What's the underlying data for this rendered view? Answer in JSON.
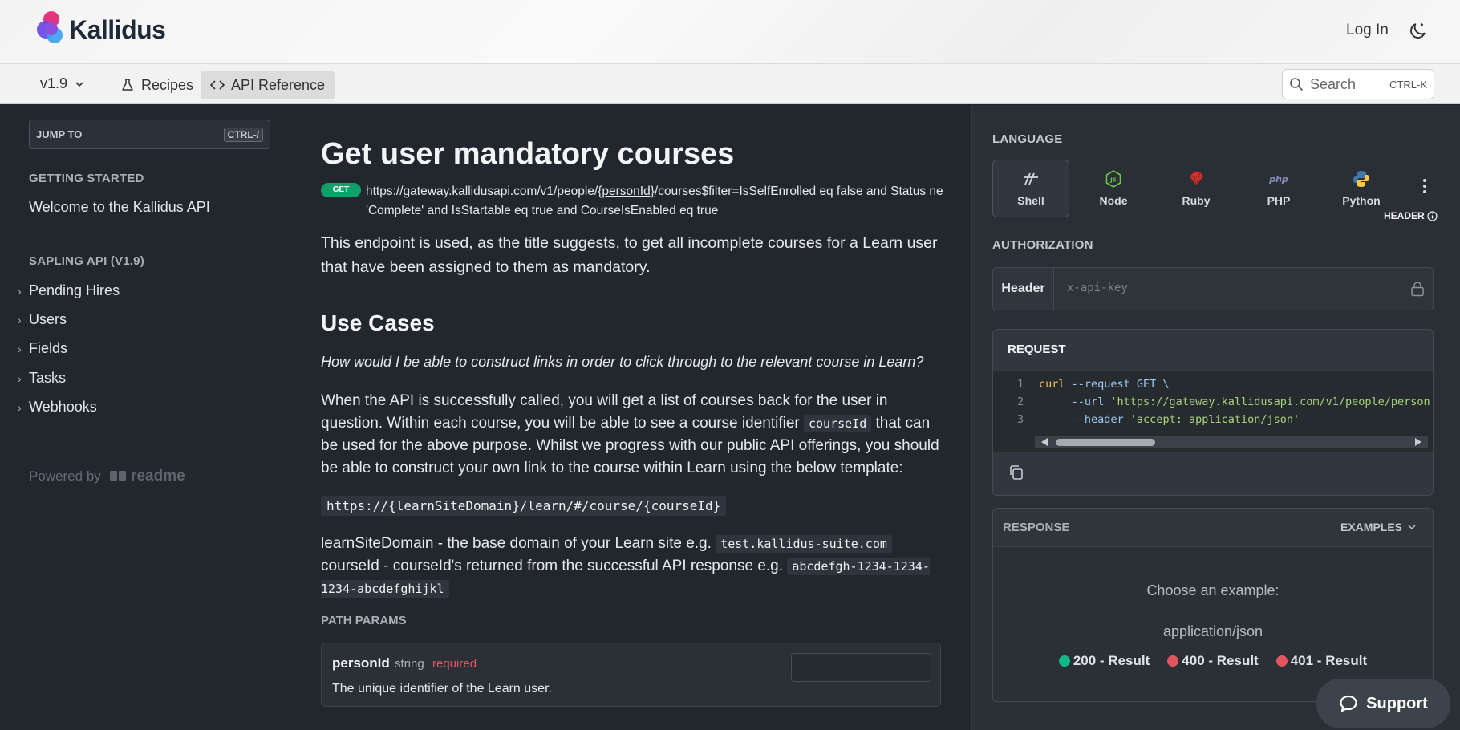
{
  "header": {
    "brand": "Kallidus",
    "login_label": "Log In",
    "version_label": "v1.9",
    "nav": [
      {
        "label": "Recipes"
      },
      {
        "label": "API Reference"
      }
    ],
    "search_label": "Search",
    "search_shortcut": "CTRL-K"
  },
  "sidebar": {
    "jump_to": "JUMP TO",
    "jump_shortcut": "CTRL-/",
    "section1_title": "GETTING STARTED",
    "section1_link": "Welcome to the Kallidus API",
    "section2_title": "SAPLING API (V1.9)",
    "items": [
      {
        "label": "Pending Hires"
      },
      {
        "label": "Users"
      },
      {
        "label": "Fields"
      },
      {
        "label": "Tasks"
      },
      {
        "label": "Webhooks"
      }
    ],
    "powered_by": "Powered by",
    "powered_brand": "readme"
  },
  "main": {
    "title": "Get user mandatory courses",
    "method": "GET",
    "url_prefix": "https://gateway.kallidusapi.com/v1/people/",
    "url_param": "{personId}",
    "url_suffix": "/courses$filter=IsSelfEnrolled eq false and Status ne 'Complete' and IsStartable eq true and CourseIsEnabled eq true",
    "intro": "This endpoint is used, as the title suggests, to get all incomplete courses for a Learn user that have been assigned to them as mandatory.",
    "use_cases_heading": "Use Cases",
    "question": "How would I be able to construct links in order to click through to the relevant course in Learn?",
    "p2_a": "When the API is successfully called, you will get a list of courses back for the user in question. Within each course, you will be able to see a course identifier ",
    "p2_code": "courseId",
    "p2_b": " that can be used for the above purpose. Whilst we progress with our public API offerings, you should be able to construct your own link to the course within Learn using the below template:",
    "template": "https://{learnSiteDomain}/learn/#/course/{courseId}",
    "p3_a": "learnSiteDomain - the base domain of your Learn site e.g. ",
    "p3_code1": "test.kallidus-suite.com",
    "p3_b": "courseId - courseId's returned from the successful API response e.g. ",
    "p3_code2": "abcdefgh-1234-1234-1234-abcdefghijkl",
    "path_params_title": "PATH PARAMS",
    "param": {
      "name": "personId",
      "type": "string",
      "required": "required",
      "description": "The unique identifier of the Learn user."
    }
  },
  "right": {
    "language_title": "LANGUAGE",
    "languages": [
      {
        "label": "Shell"
      },
      {
        "label": "Node"
      },
      {
        "label": "Ruby"
      },
      {
        "label": "PHP"
      },
      {
        "label": "Python"
      }
    ],
    "auth_title": "AUTHORIZATION",
    "auth_hint": "HEADER",
    "auth_header_label": "Header",
    "auth_placeholder": "x-api-key",
    "request_title": "REQUEST",
    "code_lines": [
      {
        "n": "1",
        "cmd": "curl",
        "rest": " --request GET \\"
      },
      {
        "n": "2",
        "flag": "     --url",
        "str": " 'https://gateway.kallidusapi.com/v1/people/person"
      },
      {
        "n": "3",
        "flag": "     --header",
        "str": " 'accept: application/json'"
      }
    ],
    "response_title": "RESPONSE",
    "examples_label": "EXAMPLES",
    "choose_label": "Choose an example:",
    "mime": "application/json",
    "results": [
      {
        "label": "200 - Result",
        "color": "#12b886"
      },
      {
        "label": "400 - Result",
        "color": "#e0555e"
      },
      {
        "label": "401 - Result",
        "color": "#e0555e"
      }
    ]
  },
  "support_label": "Support"
}
